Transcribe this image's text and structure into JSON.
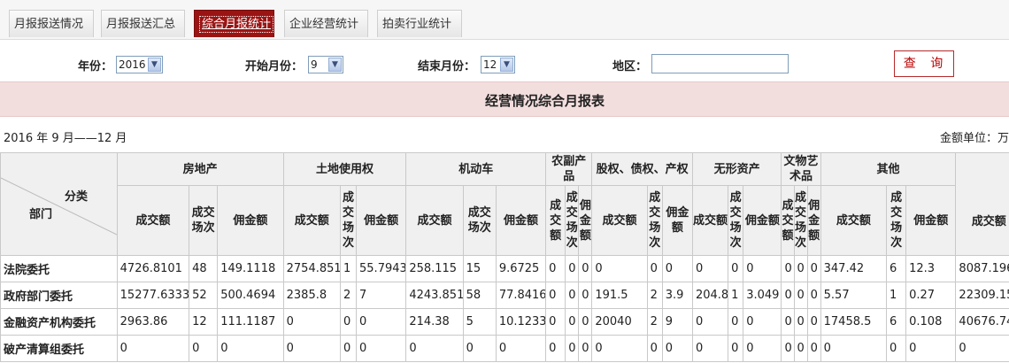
{
  "tabs": [
    "月报报送情况",
    "月报报送汇总",
    "综合月报统计",
    "企业经营统计",
    "拍卖行业统计"
  ],
  "active_tab": "综合月报统计",
  "filters": {
    "year_label": "年份：",
    "year_value": "2016",
    "start_label": "开始月份：",
    "start_value": "9",
    "end_label": "结束月份：",
    "end_value": "12",
    "region_label": "地区：",
    "region_value": "",
    "query_button": "查 询"
  },
  "report": {
    "title": "经营情况综合月报表",
    "period": "2016 年 9 月——12 月",
    "unit": "金额单位：万"
  },
  "table": {
    "corner_top": "分类",
    "corner_bottom": "部门",
    "groups": [
      "房地产",
      "土地使用权",
      "机动车",
      "农副产品",
      "股权、债权、产权",
      "无形资产",
      "文物艺术品",
      "其他"
    ],
    "sub_headers": [
      "成交额",
      "成交场次",
      "佣金额"
    ],
    "rows": [
      {
        "dept": "法院委托",
        "cells": [
          "4726.8101",
          "48",
          "149.1118",
          "2754.851",
          "1",
          "55.7943",
          "258.115",
          "15",
          "9.6725",
          "0",
          "0",
          "0",
          "0",
          "0",
          "0",
          "0",
          "0",
          "0",
          "0",
          "0",
          "0",
          "347.42",
          "6",
          "12.3",
          "8087.196"
        ]
      },
      {
        "dept": "政府部门委托",
        "cells": [
          "15277.6333",
          "52",
          "500.4694",
          "2385.8",
          "2",
          "7",
          "4243.851",
          "58",
          "77.8416",
          "0",
          "0",
          "0",
          "191.5",
          "2",
          "3.9",
          "204.8",
          "1",
          "3.049",
          "0",
          "0",
          "0",
          "5.57",
          "1",
          "0.27",
          "22309.15"
        ]
      },
      {
        "dept": "金融资产机构委托",
        "cells": [
          "2963.86",
          "12",
          "111.1187",
          "0",
          "0",
          "0",
          "214.38",
          "5",
          "10.1233",
          "0",
          "0",
          "0",
          "20040",
          "2",
          "9",
          "0",
          "0",
          "0",
          "0",
          "0",
          "0",
          "17458.5",
          "6",
          "0.108",
          "40676.74"
        ]
      },
      {
        "dept": "破产清算组委托",
        "cells": [
          "0",
          "0",
          "0",
          "0",
          "0",
          "0",
          "0",
          "0",
          "0",
          "0",
          "0",
          "0",
          "0",
          "0",
          "0",
          "0",
          "0",
          "0",
          "0",
          "0",
          "0",
          "0",
          "0",
          "0",
          "0"
        ]
      }
    ]
  }
}
